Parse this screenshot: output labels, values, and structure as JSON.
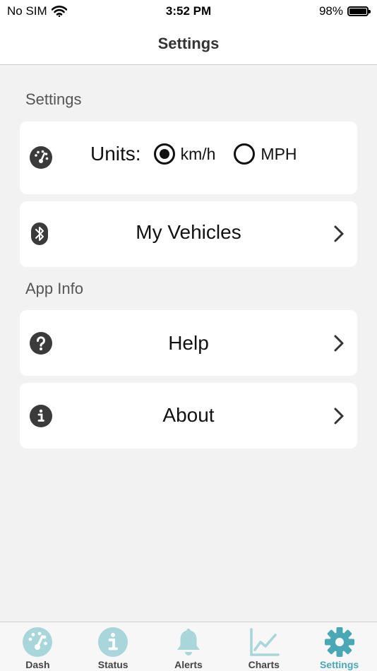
{
  "status_bar": {
    "carrier": "No SIM",
    "time": "3:52 PM",
    "battery": "98%",
    "battery_level": 0.98
  },
  "nav": {
    "title": "Settings"
  },
  "sections": {
    "settings_header": "Settings",
    "app_info_header": "App Info"
  },
  "units": {
    "label": "Units:",
    "options": [
      {
        "label": "km/h",
        "selected": true
      },
      {
        "label": "MPH",
        "selected": false
      }
    ]
  },
  "rows": {
    "my_vehicles": "My Vehicles",
    "help": "Help",
    "about": "About"
  },
  "tabs": [
    {
      "label": "Dash",
      "icon": "speedometer-icon"
    },
    {
      "label": "Status",
      "icon": "info-icon"
    },
    {
      "label": "Alerts",
      "icon": "bell-icon"
    },
    {
      "label": "Charts",
      "icon": "chart-icon"
    },
    {
      "label": "Settings",
      "icon": "gear-icon",
      "active": true
    }
  ],
  "colors": {
    "accent": "#4aa7b5",
    "tab_icon": "#a8d6da",
    "icon_dark": "#3b3b3b"
  }
}
